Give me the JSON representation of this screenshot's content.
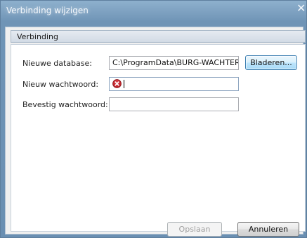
{
  "window": {
    "title": "Verbinding wijzigen",
    "close_glyph": "✕"
  },
  "group": {
    "header": "Verbinding"
  },
  "form": {
    "database_label": "Nieuwe database:",
    "database_value": "C:\\ProgramData\\BURG-WACHTER\\",
    "browse_label": "Bladeren...",
    "password_label": "Nieuw wachtwoord:",
    "password_value": "",
    "password_error_icon": "error-icon",
    "confirm_label": "Bevestig wachtwoord:",
    "confirm_value": ""
  },
  "actions": {
    "ok_label": "Opslaan",
    "cancel_label": "Annuleren"
  },
  "colors": {
    "title_bar": "#6f94b6",
    "error": "#c0262d",
    "browse_highlight": "#3c7fb1"
  }
}
